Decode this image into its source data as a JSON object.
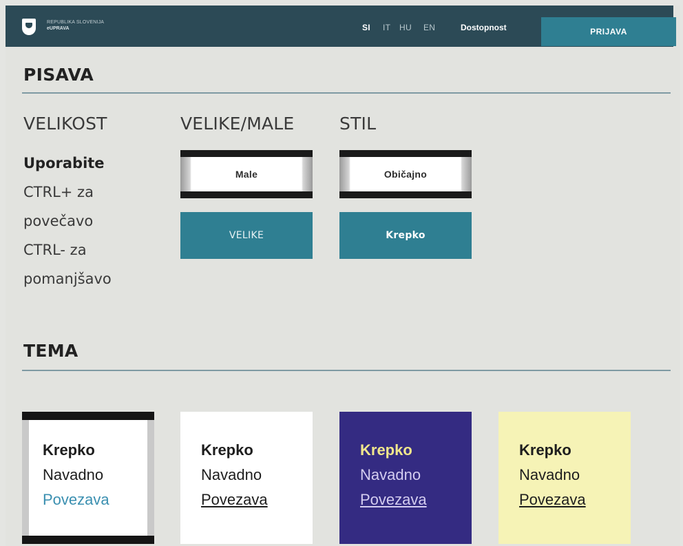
{
  "header": {
    "brand_line1": "REPUBLIKA SLOVENIJA",
    "brand_line2": "eUPRAVA",
    "languages": [
      "SI",
      "IT",
      "HU",
      "EN"
    ],
    "active_language": "SI",
    "accessibility_label": "Dostopnost",
    "login_label": "PRIJAVA"
  },
  "font_section": {
    "title": "PISAVA",
    "size": {
      "label": "VELIKOST",
      "hint_bold": "Uporabite",
      "hint_lines": [
        "CTRL+ za",
        "povečavo",
        "CTRL- za",
        "pomanjšavo"
      ]
    },
    "case": {
      "label": "VELIKE/MALE",
      "selected": "Male",
      "other": "VELIKE"
    },
    "style": {
      "label": "STIL",
      "selected": "Običajno",
      "other": "Krepko"
    }
  },
  "theme_section": {
    "title": "TEMA",
    "cards": [
      {
        "bold": "Krepko",
        "normal": "Navadno",
        "link": "Povezava",
        "selected": true
      },
      {
        "bold": "Krepko",
        "normal": "Navadno",
        "link": "Povezava",
        "selected": false
      },
      {
        "bold": "Krepko",
        "normal": "Navadno",
        "link": "Povezava",
        "selected": false
      },
      {
        "bold": "Krepko",
        "normal": "Navadno",
        "link": "Povezava",
        "selected": false
      }
    ]
  },
  "colors": {
    "header_bg": "#2c4a56",
    "accent": "#2f7f92",
    "page_bg": "#e2e3df",
    "theme_dark_bg": "#342b82",
    "theme_yellow_bg": "#f6f3b6"
  }
}
